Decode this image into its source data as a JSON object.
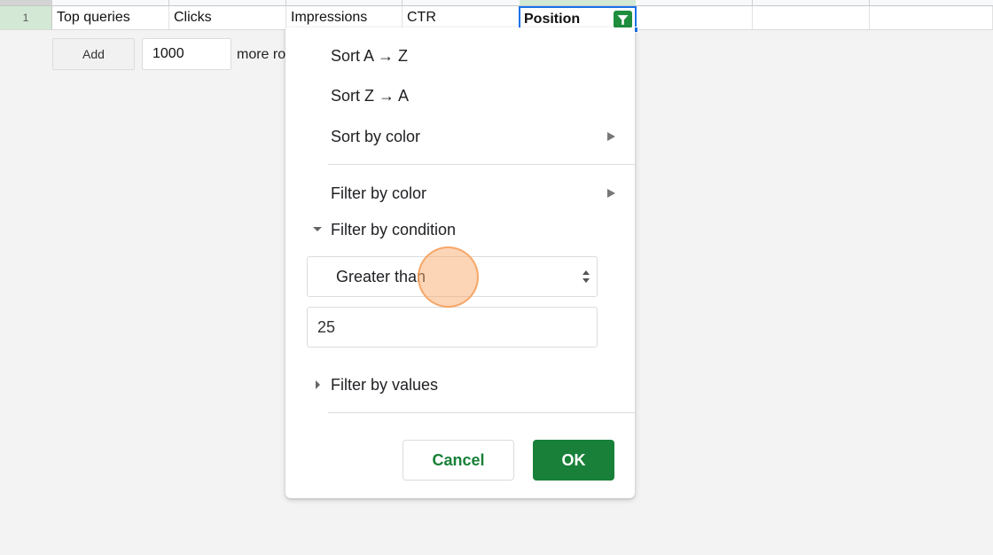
{
  "sheet": {
    "row_number": "1",
    "cells": [
      "Top queries",
      "Clicks",
      "Impressions",
      "CTR",
      "Position",
      "",
      "",
      ""
    ],
    "active_cell_index": 4
  },
  "add_rows": {
    "button_label": "Add",
    "count_value": "1000",
    "suffix_label": "more rows at bottom"
  },
  "filter_menu": {
    "sort_az": "Sort A → Z",
    "sort_za": "Sort Z → A",
    "sort_by_color": "Sort by color",
    "filter_by_color": "Filter by color",
    "filter_by_condition": "Filter by condition",
    "condition_selected": "Greater than",
    "condition_value": "25",
    "filter_by_values": "Filter by values",
    "cancel_label": "Cancel",
    "ok_label": "OK"
  },
  "colors": {
    "accent_green": "#188038",
    "selection_blue": "#1a73e8",
    "row_header_selected": "#d3e9d6",
    "click_indicator": "#f5a05a"
  },
  "icons": {
    "filter": "filter-funnel-icon",
    "submenu": "submenu-arrow-icon",
    "expand": "triangle-down-icon",
    "collapse": "triangle-right-icon",
    "select_arrows": "updown-arrows-icon"
  }
}
